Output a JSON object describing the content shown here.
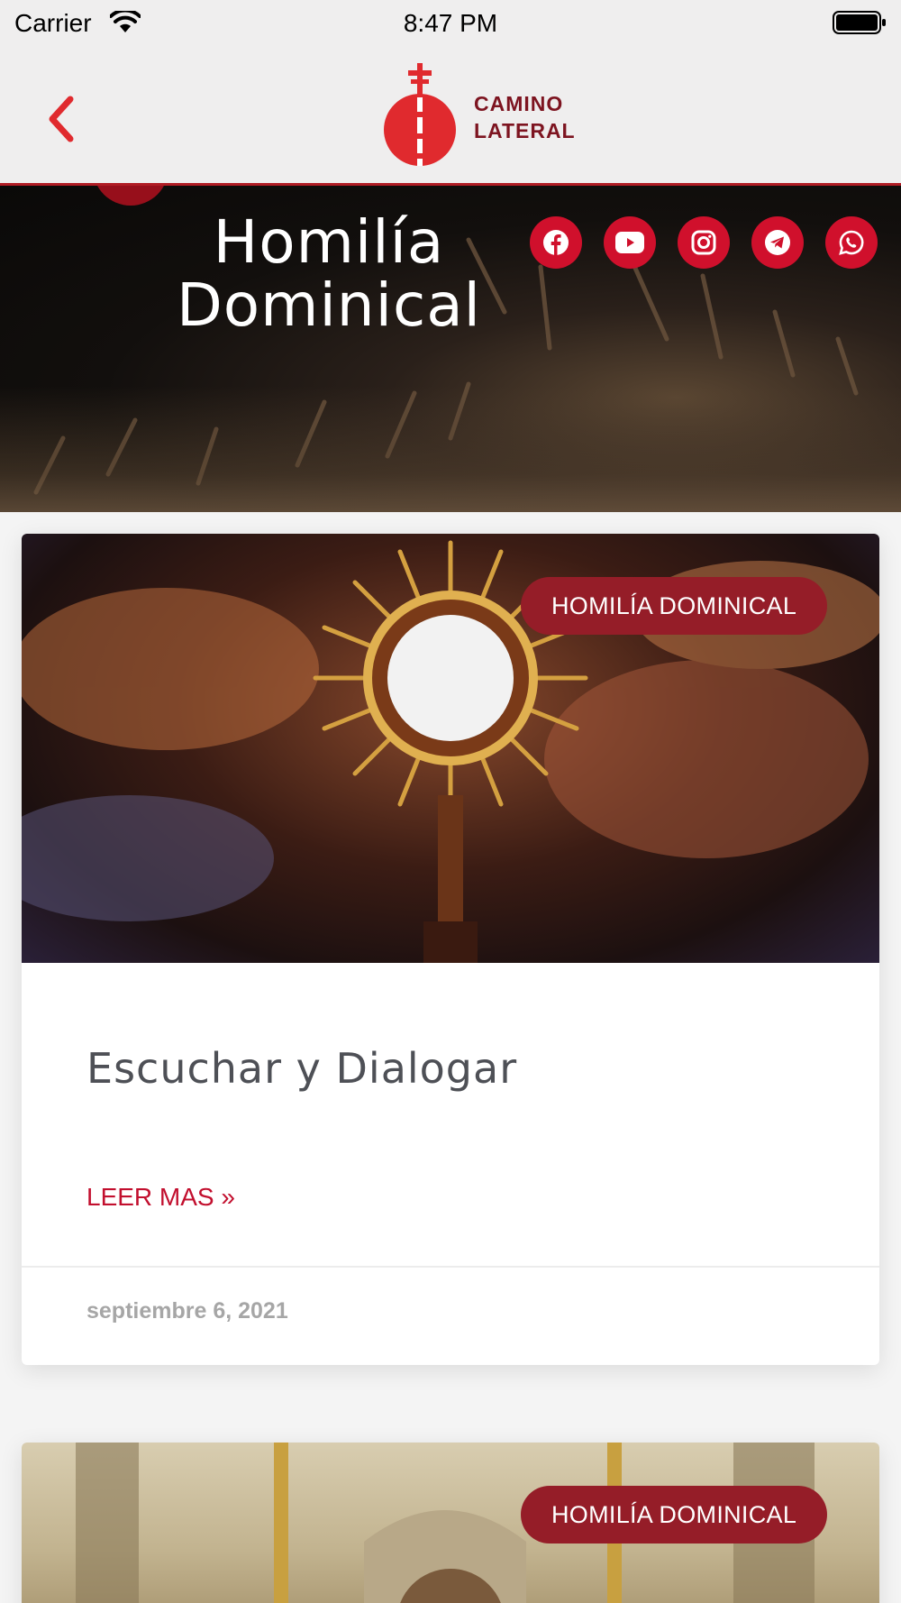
{
  "status_bar": {
    "carrier": "Carrier",
    "time": "8:47 PM"
  },
  "nav": {
    "logo_line1": "CAMINO",
    "logo_line2": "LATERAL",
    "icons": {
      "back": "chevron-left-icon"
    }
  },
  "hero": {
    "title_line1": "Homilía",
    "title_line2": "Dominical",
    "social_icons": [
      "facebook-icon",
      "youtube-icon",
      "instagram-icon",
      "telegram-icon",
      "whatsapp-icon"
    ]
  },
  "posts": [
    {
      "category": "HOMILÍA DOMINICAL",
      "title": "Escuchar y Dialogar",
      "read_more": "LEER MAS »",
      "date": "septiembre 6, 2021"
    },
    {
      "category": "HOMILÍA DOMINICAL"
    }
  ],
  "colors": {
    "accent": "#d0102c",
    "badge": "#951d28",
    "brand_dark": "#7d1420"
  }
}
